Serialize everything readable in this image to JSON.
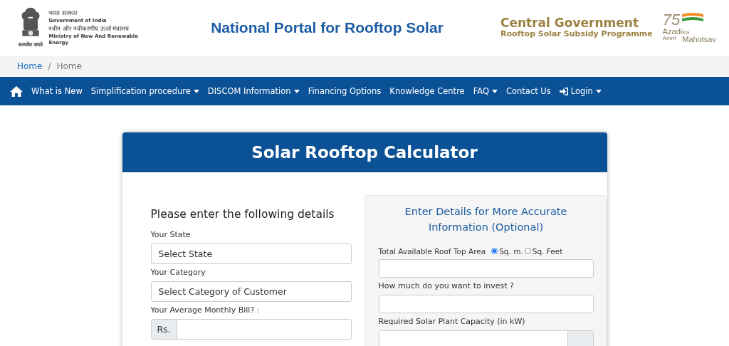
{
  "header": {
    "gov_hindi": "भारत सरकार",
    "gov_english": "Government of India",
    "ministry_hindi": "नवीन और नवीकरणीय ऊर्जा मंत्रालय",
    "ministry_english": "Ministry of New And Renewable Energy",
    "emblem_caption": "सत्यमेव जयते",
    "portal_title": "National Portal for Rooftop Solar",
    "programme_title": "Central Government",
    "programme_subtitle": "Rooftop Solar Subsidy Programme",
    "azadi": {
      "number": "75",
      "line1": "Azadi",
      "ka": "Ka",
      "amrit": "Amrit",
      "mahotsav": "Mahotsav"
    }
  },
  "breadcrumb": [
    {
      "label": "Home",
      "link": true
    },
    {
      "label": "Home",
      "link": false
    }
  ],
  "breadcrumb_separator": "/",
  "nav": [
    {
      "label": "What is New",
      "dropdown": false
    },
    {
      "label": "Simplification procedure",
      "dropdown": true
    },
    {
      "label": "DISCOM Information",
      "dropdown": true
    },
    {
      "label": "Financing Options",
      "dropdown": false
    },
    {
      "label": "Knowledge Centre",
      "dropdown": false
    },
    {
      "label": "FAQ",
      "dropdown": true
    },
    {
      "label": "Contact Us",
      "dropdown": false
    },
    {
      "label": "Login",
      "dropdown": true,
      "kind": "login"
    }
  ],
  "card": {
    "title": "Solar Rooftop Calculator",
    "left": {
      "heading": "Please enter the following details",
      "fields": [
        {
          "label": "Your State",
          "kind": "select",
          "value": "Select State"
        },
        {
          "label": "Your Category",
          "kind": "select",
          "value": "Select Category of Customer"
        },
        {
          "label": "Your Average Monthly Bill? :",
          "kind": "addon",
          "addon": "Rs."
        }
      ]
    },
    "right": {
      "heading": "Enter Details for More Accurate Information (Optional)",
      "area_label": "Total Available Roof Top Area",
      "units": [
        {
          "label": "Sq. m.",
          "selected": true
        },
        {
          "label": "Sq. Feet",
          "selected": false
        }
      ],
      "fields": [
        {
          "label": "How much do you want to invest ?",
          "kind": "input"
        },
        {
          "label": "Required Solar Plant Capacity (in kW)",
          "kind": "addon-right"
        }
      ]
    }
  }
}
